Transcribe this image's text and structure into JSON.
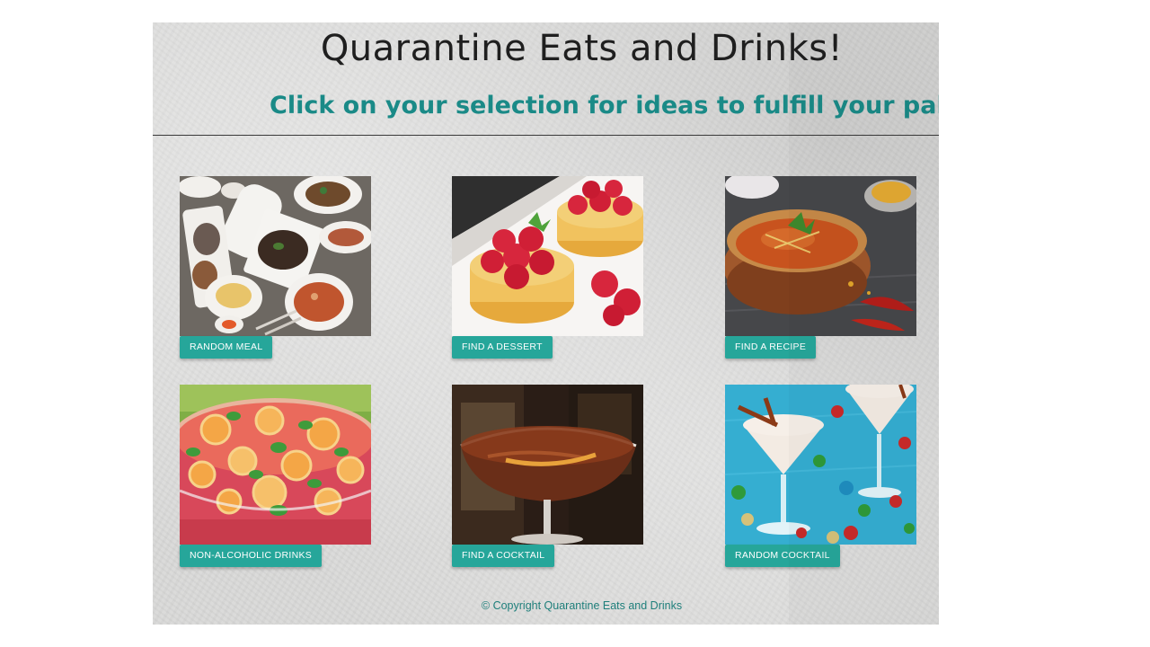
{
  "header": {
    "title": "Quarantine Eats and Drinks!",
    "subtitle": "Click on your selection for ideas to fulfill your palatte!"
  },
  "cards": [
    {
      "label": "RANDOM MEAL",
      "image": "asian-meal-spread-photo"
    },
    {
      "label": "FIND A DESSERT",
      "image": "raspberry-tarts-photo"
    },
    {
      "label": "FIND A RECIPE",
      "image": "curry-bowl-photo"
    },
    {
      "label": "NON-ALCOHOLIC DRINKS",
      "image": "citrus-punch-bowl-photo"
    },
    {
      "label": "FIND A COCKTAIL",
      "image": "cocktail-coupe-photo"
    },
    {
      "label": "RANDOM COCKTAIL",
      "image": "holiday-cocktails-photo"
    }
  ],
  "footer": {
    "copyright": "© Copyright Quarantine Eats and Drinks"
  },
  "colors": {
    "accent": "#26a69a",
    "subtitle": "#1a8a87"
  }
}
